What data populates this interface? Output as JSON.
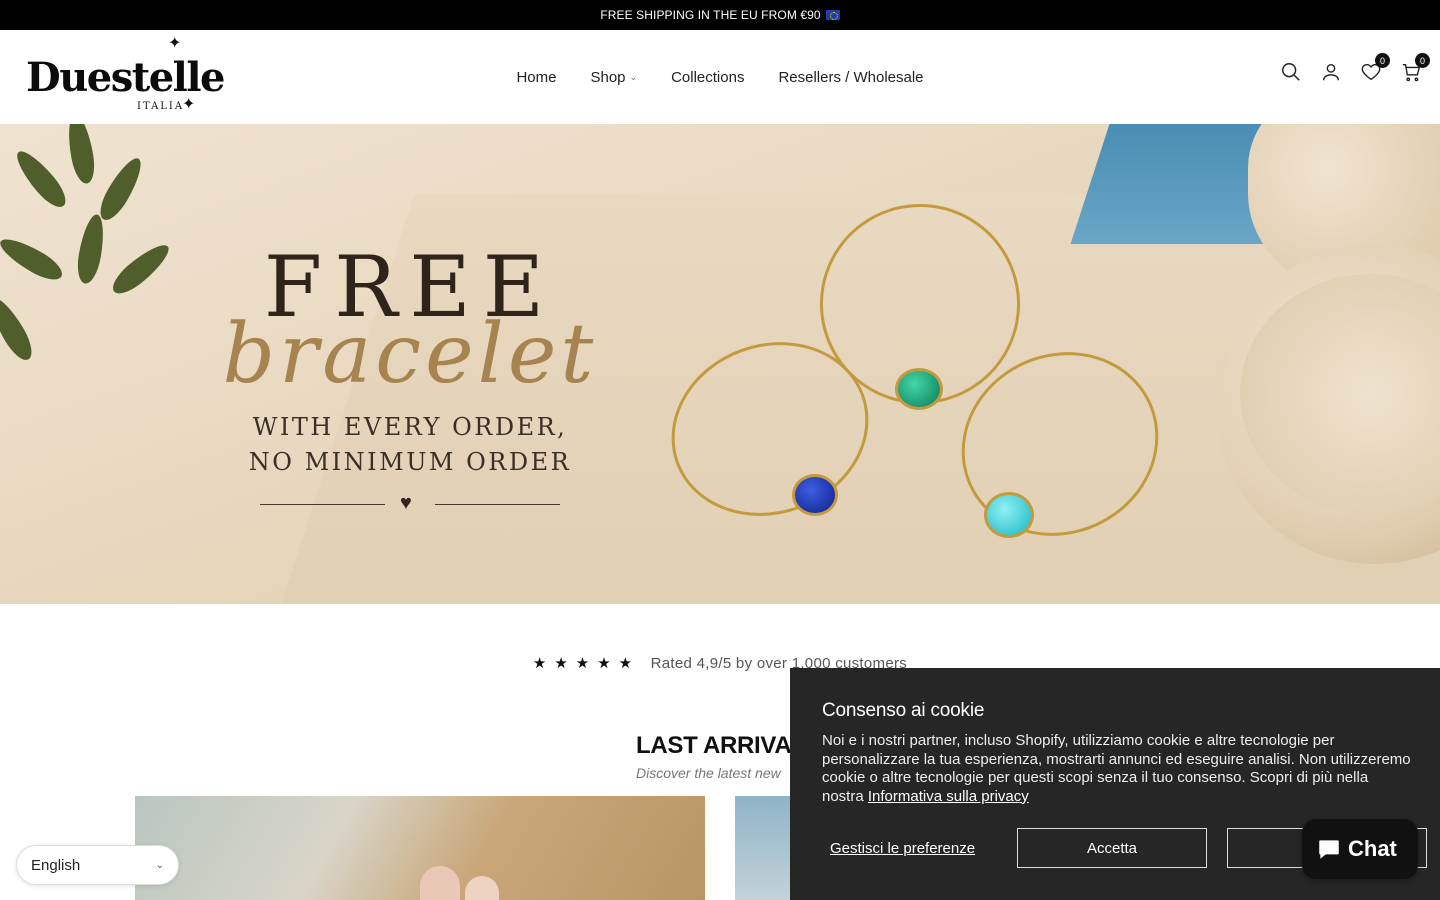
{
  "announcement": {
    "text": "FREE SHIPPING IN THE EU FROM €90"
  },
  "brand": {
    "name": "Duestelle",
    "sub": "ITALIA"
  },
  "nav": {
    "items": [
      {
        "label": "Home"
      },
      {
        "label": "Shop"
      },
      {
        "label": "Collections"
      },
      {
        "label": "Resellers / Wholesale"
      }
    ]
  },
  "header_icons": {
    "wishlist_count": "0",
    "cart_count": "0"
  },
  "hero": {
    "title": "FREE",
    "script": "bracelet",
    "line1": "WITH EVERY ORDER,",
    "line2": "NO MINIMUM ORDER"
  },
  "rating": {
    "stars": "★★★★★",
    "text": "Rated 4,9/5 by over 1.000 customers"
  },
  "section": {
    "title": "LAST ARRIVALS",
    "subtitle": "Discover the latest new"
  },
  "language": {
    "selected": "English"
  },
  "cookie": {
    "title": "Consenso ai cookie",
    "body": "Noi e i nostri partner, incluso Shopify, utilizziamo cookie e altre tecnologie per personalizzare la tua esperienza, mostrarti annunci ed eseguire analisi. Non utilizzeremo cookie o altre tecnologie per questi scopi senza il tuo consenso. Scopri di più nella nostra ",
    "link": "Informativa sulla privacy",
    "manage": "Gestisci le preferenze",
    "accept": "Accetta",
    "decline": "De"
  },
  "chat": {
    "label": "Chat"
  },
  "colors": {
    "accent": "#a6834f",
    "dark": "#262626",
    "gold": "#c49a3e"
  }
}
